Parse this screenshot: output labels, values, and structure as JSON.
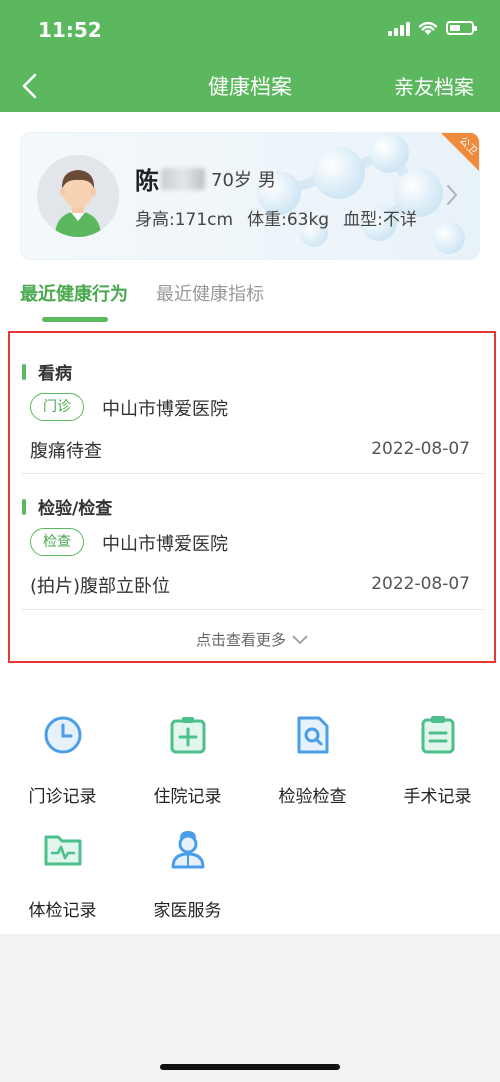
{
  "status": {
    "time": "11:52"
  },
  "nav": {
    "title": "健康档案",
    "right_label": "亲友档案"
  },
  "profile": {
    "name": "陈",
    "age": "70岁",
    "sex": "男",
    "height": "身高:171cm",
    "weight": "体重:63kg",
    "blood": "血型:不详",
    "corner_tag": "公卫"
  },
  "tabs": [
    {
      "label": "最近健康行为",
      "active": true
    },
    {
      "label": "最近健康指标",
      "active": false
    }
  ],
  "records": [
    {
      "type": "看病",
      "tag": "门诊",
      "hospital": "中山市博爱医院",
      "desc": "腹痛待查",
      "date": "2022-08-07"
    },
    {
      "type": "检验/检查",
      "tag": "检查",
      "hospital": "中山市博爱医院",
      "desc": "(拍片)腹部立卧位",
      "date": "2022-08-07"
    }
  ],
  "more_label": "点击查看更多",
  "functions": [
    {
      "label": "门诊记录",
      "icon": "clock-icon"
    },
    {
      "label": "住院记录",
      "icon": "hospital-plus-icon"
    },
    {
      "label": "检验检查",
      "icon": "document-search-icon"
    },
    {
      "label": "手术记录",
      "icon": "clipboard-list-icon"
    },
    {
      "label": "体检记录",
      "icon": "folder-pulse-icon"
    },
    {
      "label": "家医服务",
      "icon": "doctor-icon"
    }
  ],
  "colors": {
    "primary": "#5cb85f",
    "highlight_border": "#e53935",
    "icon_blue": "#4a9ee8",
    "icon_green": "#4cc08a"
  }
}
